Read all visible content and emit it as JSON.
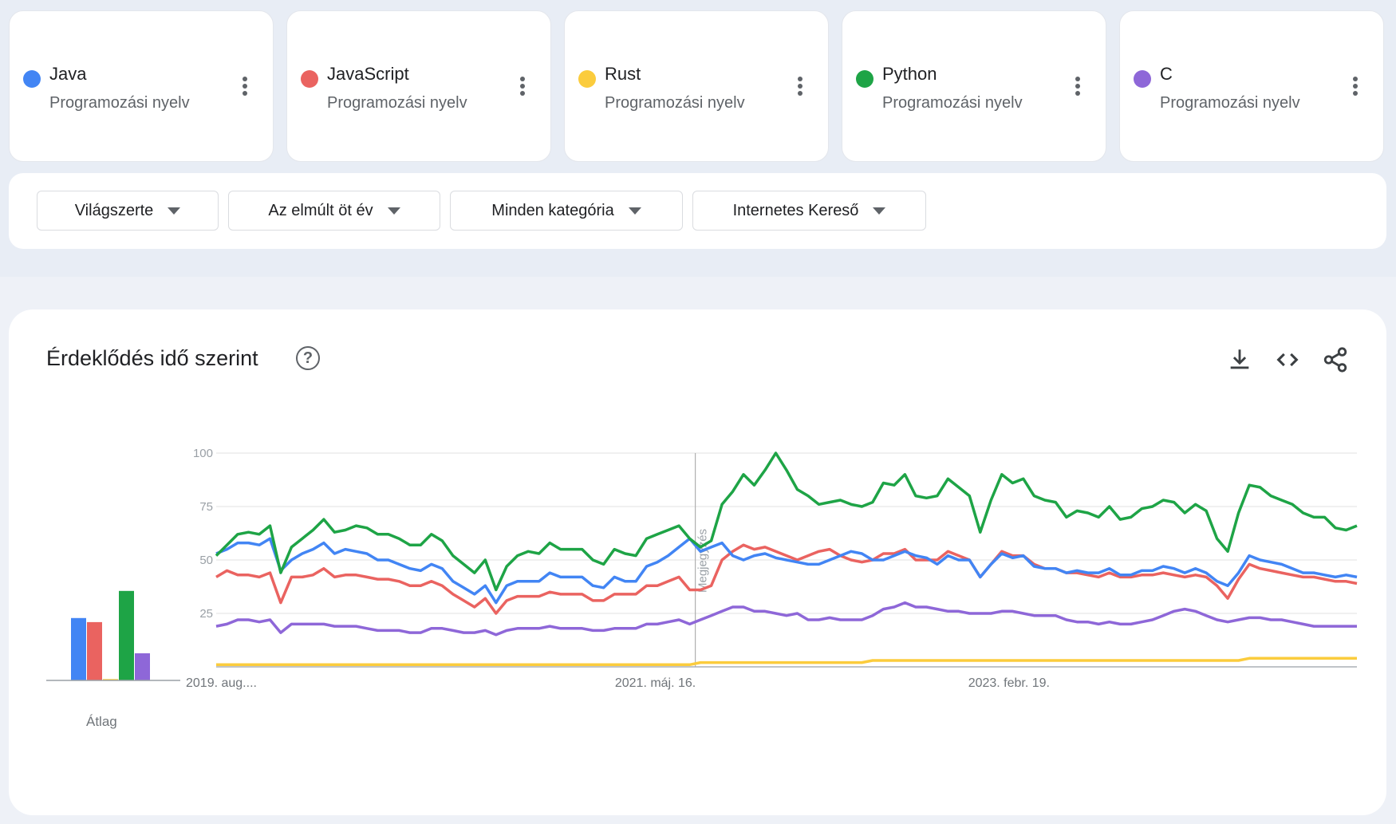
{
  "terms": [
    {
      "name": "Java",
      "subtitle": "Programozási nyelv",
      "color": "#4285f4"
    },
    {
      "name": "JavaScript",
      "subtitle": "Programozási nyelv",
      "color": "#ea6360"
    },
    {
      "name": "Rust",
      "subtitle": "Programozási nyelv",
      "color": "#fbcc3d"
    },
    {
      "name": "Python",
      "subtitle": "Programozási nyelv",
      "color": "#1ea446"
    },
    {
      "name": "C",
      "subtitle": "Programozási nyelv",
      "color": "#8e67d8"
    }
  ],
  "filters": {
    "region": "Világszerte",
    "period": "Az elmúlt öt év",
    "category": "Minden kategória",
    "source": "Internetes Kereső"
  },
  "chart_card": {
    "title": "Érdeklődés idő szerint",
    "help_icon": "help-circle-icon",
    "actions": [
      "download-icon",
      "embed-code-icon",
      "share-icon"
    ]
  },
  "chart_data": {
    "type": "line",
    "x_tick_labels": [
      "2019. aug....",
      "2021. máj. 16.",
      "2023. febr. 19."
    ],
    "ylim": [
      0,
      100
    ],
    "y_ticks": [
      25,
      50,
      75,
      100
    ],
    "annotation": "Megjegyzés",
    "average_label": "Átlag",
    "averages": [
      {
        "name": "Java",
        "value": 46
      },
      {
        "name": "JavaScript",
        "value": 43
      },
      {
        "name": "Rust",
        "value": 1
      },
      {
        "name": "Python",
        "value": 66
      },
      {
        "name": "C",
        "value": 20
      }
    ],
    "series": [
      {
        "name": "Python",
        "color": "#1ea446",
        "values": [
          52,
          57,
          62,
          63,
          62,
          66,
          44,
          56,
          60,
          64,
          69,
          63,
          64,
          66,
          65,
          62,
          62,
          60,
          57,
          57,
          62,
          59,
          52,
          48,
          44,
          50,
          36,
          47,
          52,
          54,
          53,
          58,
          55,
          55,
          55,
          50,
          48,
          55,
          53,
          52,
          60,
          62,
          64,
          66,
          60,
          56,
          59,
          76,
          82,
          90,
          85,
          92,
          100,
          92,
          83,
          80,
          76,
          77,
          78,
          76,
          75,
          77,
          86,
          85,
          90,
          80,
          79,
          80,
          88,
          84,
          80,
          63,
          78,
          90,
          86,
          88,
          80,
          78,
          77,
          70,
          73,
          72,
          70,
          75,
          69,
          70,
          74,
          75,
          78,
          77,
          72,
          76,
          73,
          60,
          54,
          72,
          85,
          84,
          80,
          78,
          76,
          72,
          70,
          70,
          65,
          64,
          66
        ]
      },
      {
        "name": "Java",
        "color": "#4285f4",
        "values": [
          53,
          55,
          58,
          58,
          57,
          60,
          45,
          50,
          53,
          55,
          58,
          53,
          55,
          54,
          53,
          50,
          50,
          48,
          46,
          45,
          48,
          46,
          40,
          37,
          34,
          38,
          30,
          38,
          40,
          40,
          40,
          44,
          42,
          42,
          42,
          38,
          37,
          42,
          40,
          40,
          47,
          49,
          52,
          56,
          60,
          54,
          56,
          58,
          52,
          50,
          52,
          53,
          51,
          50,
          49,
          48,
          48,
          50,
          52,
          54,
          53,
          50,
          50,
          52,
          54,
          52,
          51,
          48,
          52,
          50,
          50,
          42,
          48,
          53,
          51,
          52,
          47,
          46,
          46,
          44,
          45,
          44,
          44,
          46,
          43,
          43,
          45,
          45,
          47,
          46,
          44,
          46,
          44,
          40,
          38,
          44,
          52,
          50,
          49,
          48,
          46,
          44,
          44,
          43,
          42,
          43,
          42
        ]
      },
      {
        "name": "JavaScript",
        "color": "#ea6360",
        "values": [
          42,
          45,
          43,
          43,
          42,
          44,
          30,
          42,
          42,
          43,
          46,
          42,
          43,
          43,
          42,
          41,
          41,
          40,
          38,
          38,
          40,
          38,
          34,
          31,
          28,
          32,
          25,
          31,
          33,
          33,
          33,
          35,
          34,
          34,
          34,
          31,
          31,
          34,
          34,
          34,
          38,
          38,
          40,
          42,
          36,
          36,
          38,
          50,
          54,
          57,
          55,
          56,
          54,
          52,
          50,
          52,
          54,
          55,
          52,
          50,
          49,
          50,
          53,
          53,
          55,
          50,
          50,
          50,
          54,
          52,
          50,
          42,
          48,
          54,
          52,
          52,
          48,
          46,
          46,
          44,
          44,
          43,
          42,
          44,
          42,
          42,
          43,
          43,
          44,
          43,
          42,
          43,
          42,
          38,
          32,
          41,
          48,
          46,
          45,
          44,
          43,
          42,
          42,
          41,
          40,
          40,
          39
        ]
      },
      {
        "name": "C",
        "color": "#8e67d8",
        "values": [
          19,
          20,
          22,
          22,
          21,
          22,
          16,
          20,
          20,
          20,
          20,
          19,
          19,
          19,
          18,
          17,
          17,
          17,
          16,
          16,
          18,
          18,
          17,
          16,
          16,
          17,
          15,
          17,
          18,
          18,
          18,
          19,
          18,
          18,
          18,
          17,
          17,
          18,
          18,
          18,
          20,
          20,
          21,
          22,
          20,
          22,
          24,
          26,
          28,
          28,
          26,
          26,
          25,
          24,
          25,
          22,
          22,
          23,
          22,
          22,
          22,
          24,
          27,
          28,
          30,
          28,
          28,
          27,
          26,
          26,
          25,
          25,
          25,
          26,
          26,
          25,
          24,
          24,
          24,
          22,
          21,
          21,
          20,
          21,
          20,
          20,
          21,
          22,
          24,
          26,
          27,
          26,
          24,
          22,
          21,
          22,
          23,
          23,
          22,
          22,
          21,
          20,
          19,
          19,
          19,
          19,
          19
        ]
      },
      {
        "name": "Rust",
        "color": "#fbcc3d",
        "values": [
          1,
          1,
          1,
          1,
          1,
          1,
          1,
          1,
          1,
          1,
          1,
          1,
          1,
          1,
          1,
          1,
          1,
          1,
          1,
          1,
          1,
          1,
          1,
          1,
          1,
          1,
          1,
          1,
          1,
          1,
          1,
          1,
          1,
          1,
          1,
          1,
          1,
          1,
          1,
          1,
          1,
          1,
          1,
          1,
          1,
          2,
          2,
          2,
          2,
          2,
          2,
          2,
          2,
          2,
          2,
          2,
          2,
          2,
          2,
          2,
          2,
          3,
          3,
          3,
          3,
          3,
          3,
          3,
          3,
          3,
          3,
          3,
          3,
          3,
          3,
          3,
          3,
          3,
          3,
          3,
          3,
          3,
          3,
          3,
          3,
          3,
          3,
          3,
          3,
          3,
          3,
          3,
          3,
          3,
          3,
          3,
          4,
          4,
          4,
          4,
          4,
          4,
          4,
          4,
          4,
          4,
          4
        ]
      }
    ]
  }
}
